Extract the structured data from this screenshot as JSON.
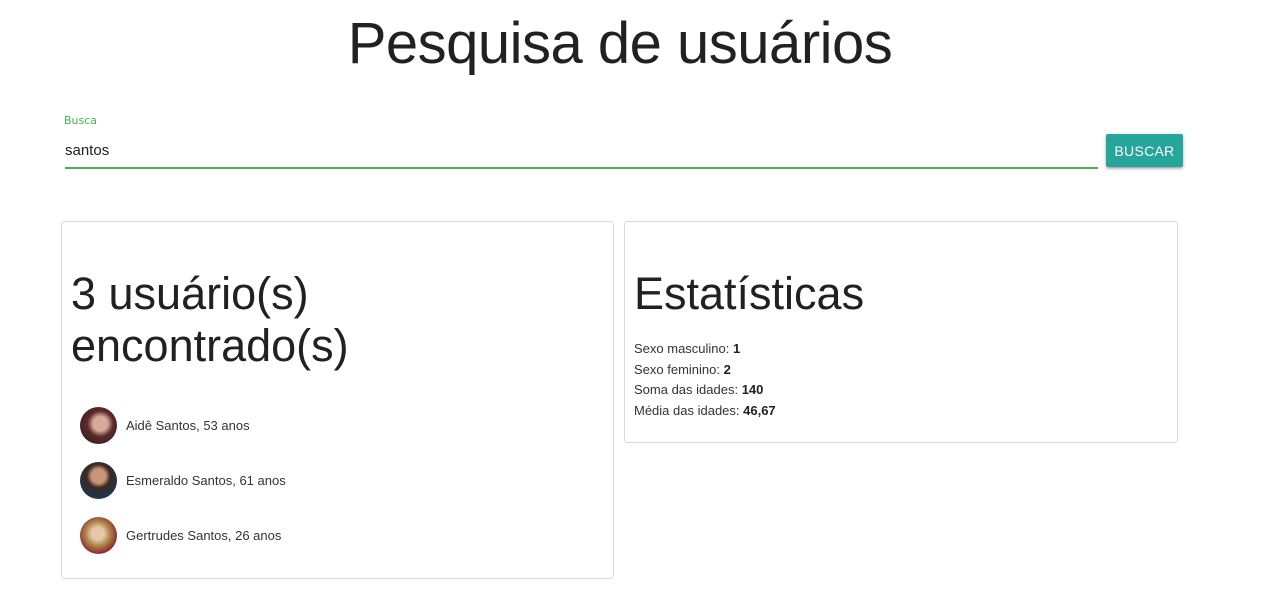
{
  "page": {
    "title": "Pesquisa de usuários"
  },
  "search": {
    "label": "Busca",
    "value": "santos",
    "button_label": "BUSCAR"
  },
  "results": {
    "heading": "3 usuário(s) encontrado(s)",
    "users": [
      {
        "text": "Aidê Santos, 53 anos"
      },
      {
        "text": "Esmeraldo Santos, 61 anos"
      },
      {
        "text": "Gertrudes Santos, 26 anos"
      }
    ]
  },
  "stats": {
    "heading": "Estatísticas",
    "items": [
      {
        "label": "Sexo masculino: ",
        "value": "1"
      },
      {
        "label": "Sexo feminino: ",
        "value": "2"
      },
      {
        "label": "Soma das idades: ",
        "value": "140"
      },
      {
        "label": "Média das idades: ",
        "value": "46,67"
      }
    ]
  },
  "colors": {
    "accent": "#26a69a",
    "input_underline": "#4caf50"
  }
}
